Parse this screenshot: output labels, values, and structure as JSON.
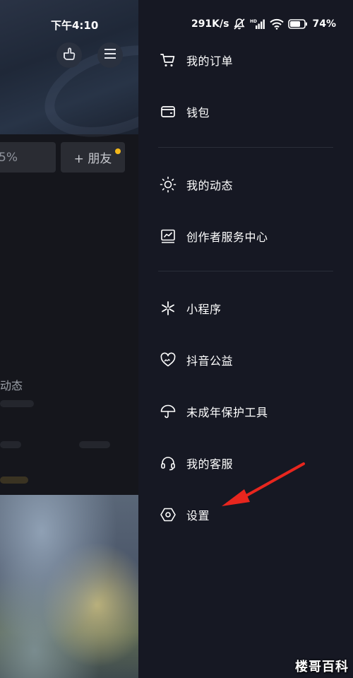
{
  "status_bar": {
    "time": "下午4:10",
    "network_speed": "291K/s",
    "battery": "74"
  },
  "background": {
    "percent_text": "5%",
    "friend_button_label": "+ 朋友",
    "activity_text": "动态"
  },
  "drawer": {
    "group1": [
      {
        "id": "orders",
        "label": "我的订单",
        "icon": "shopping-cart-icon"
      },
      {
        "id": "wallet",
        "label": "钱包",
        "icon": "wallet-icon"
      }
    ],
    "group2": [
      {
        "id": "moments",
        "label": "我的动态",
        "icon": "sun-icon"
      },
      {
        "id": "creator",
        "label": "创作者服务中心",
        "icon": "chart-monitor-icon"
      }
    ],
    "group3": [
      {
        "id": "mini-programs",
        "label": "小程序",
        "icon": "asterisk-icon"
      },
      {
        "id": "charity",
        "label": "抖音公益",
        "icon": "heart-hands-icon"
      },
      {
        "id": "minor-protection",
        "label": "未成年保护工具",
        "icon": "umbrella-icon"
      },
      {
        "id": "customer-service",
        "label": "我的客服",
        "icon": "headset-icon"
      },
      {
        "id": "settings",
        "label": "设置",
        "icon": "hexagon-settings-icon"
      }
    ]
  },
  "watermark": "楼哥百科",
  "colors": {
    "drawer_bg": "#161823",
    "annotation_arrow": "#e8261e",
    "notification_dot": "#f4b81a"
  }
}
